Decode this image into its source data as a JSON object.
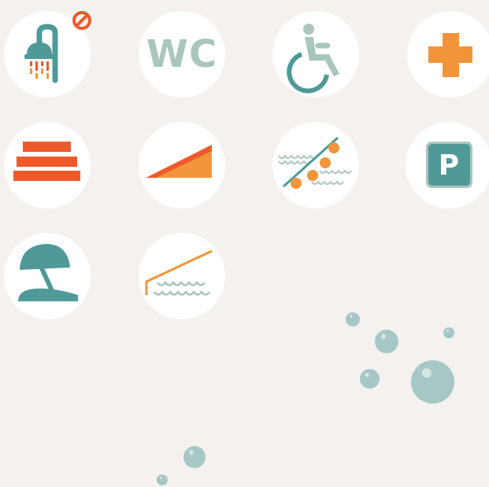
{
  "icons": {
    "wc": {
      "label": "WC"
    },
    "parking": {
      "label": "P"
    }
  },
  "colors": {
    "background": "#f4f1ef",
    "tile": "#ffffff",
    "teal": "#4f9a98",
    "sage": "#a9c5bd",
    "orange": "#f2953a",
    "red_orange": "#ef5a2b",
    "bubble": "#a6c7c6"
  },
  "icon_names": [
    "shower-icon",
    "no-sign-icon",
    "wc-icon",
    "wheelchair-icon",
    "first-aid-cross-icon",
    "steps-icon",
    "ramp-icon",
    "water-ladder-icon",
    "parking-icon",
    "beach-umbrella-icon",
    "pool-ladder-icon",
    "bubble-icon"
  ]
}
